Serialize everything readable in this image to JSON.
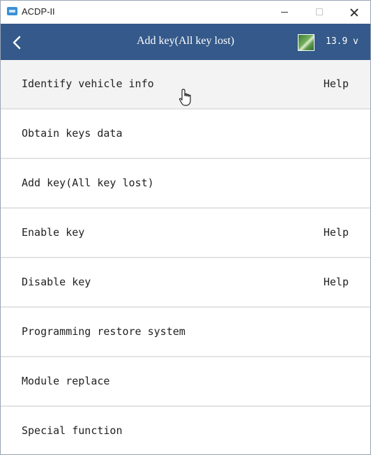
{
  "window": {
    "title": "ACDP-II"
  },
  "header": {
    "title": "Add key(All key lost)",
    "voltage": "13.9 v"
  },
  "menu": {
    "items": [
      {
        "label": "Identify vehicle info",
        "help": "Help"
      },
      {
        "label": "Obtain keys data",
        "help": ""
      },
      {
        "label": "Add key(All key lost)",
        "help": ""
      },
      {
        "label": "Enable key",
        "help": "Help"
      },
      {
        "label": "Disable key",
        "help": "Help"
      },
      {
        "label": "Programming restore system",
        "help": ""
      },
      {
        "label": "Module replace",
        "help": ""
      },
      {
        "label": "Special function",
        "help": ""
      }
    ]
  },
  "icons": {
    "app": "app-icon",
    "back": "chevron-left-icon",
    "battery": "battery-icon",
    "cursor": "hand-pointer-icon"
  },
  "colors": {
    "header_bg": "#34598a",
    "header_text": "#ffffff",
    "row_bg": "#ffffff",
    "row_active_bg": "#f3f3f3",
    "divider": "#e3e3e3"
  }
}
